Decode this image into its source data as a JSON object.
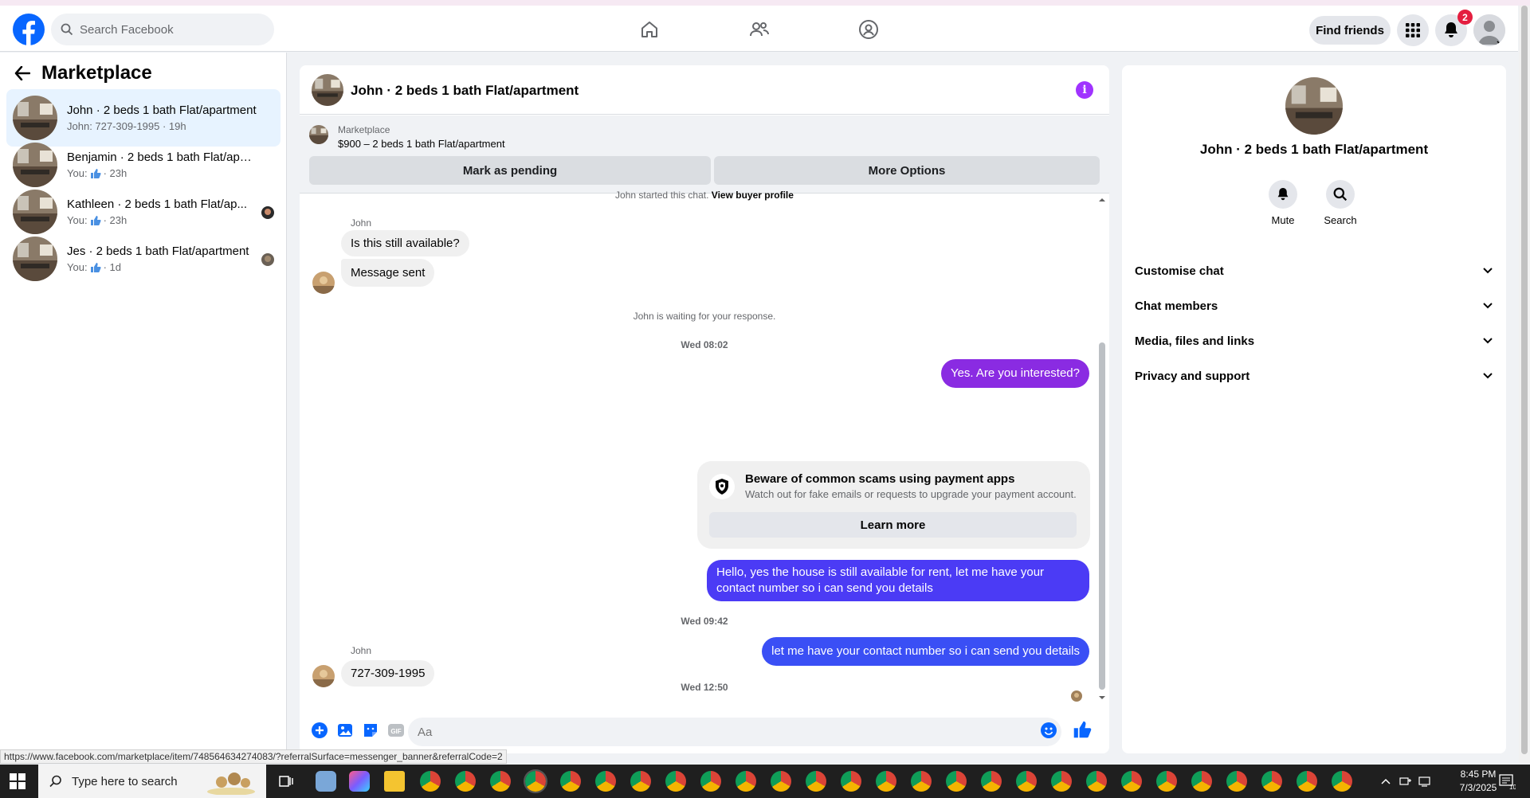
{
  "topnav": {
    "search_placeholder": "Search Facebook",
    "find_friends": "Find friends",
    "notification_count": "2"
  },
  "left": {
    "title": "Marketplace",
    "conversations": [
      {
        "title": "John · 2 beds 1 bath Flat/apartment",
        "sub": "John: 727-309-1995 · 19h",
        "active": true
      },
      {
        "title": "Benjamin · 2 beds 1 bath Flat/apar...",
        "you": "You:",
        "time": "· 23h"
      },
      {
        "title": "Kathleen · 2 beds 1 bath Flat/ap...",
        "you": "You:",
        "time": "· 23h"
      },
      {
        "title": "Jes · 2 beds 1 bath Flat/apartment",
        "you": "You:",
        "time": "· 1d"
      }
    ]
  },
  "chat": {
    "header_name": "John · 2 beds 1 bath Flat/apartment",
    "banner_label": "Marketplace",
    "banner_price": "$900 – 2 beds 1 bath Flat/apartment",
    "mark_pending": "Mark as pending",
    "more_options": "More Options",
    "started_text": "John started this chat.",
    "view_buyer_profile": "View buyer profile",
    "sender1": "John",
    "msg_in_1": "Is this still available?",
    "msg_in_2": "Message sent",
    "waiting": "John is waiting for your response.",
    "time1": "Wed 08:02",
    "msg_out_1": "Yes. Are you interested?",
    "scam_title": "Beware of common scams using payment apps",
    "scam_desc": "Watch out for fake emails or requests to upgrade your payment account.",
    "learn_more": "Learn more",
    "msg_out_2": "Hello, yes the house is still available for rent, let me have your contact number so i can send you details",
    "time2": "Wed 09:42",
    "msg_out_3": "let me have your contact number so i can send you details",
    "time3": "Wed 12:50",
    "sender2": "John",
    "msg_in_3": "727-309-1995",
    "composer_placeholder": "Aa"
  },
  "right": {
    "name": "John · 2 beds 1 bath Flat/apartment",
    "mute": "Mute",
    "search": "Search",
    "sections": [
      "Customise chat",
      "Chat members",
      "Media, files and links",
      "Privacy and support"
    ]
  },
  "status_url": "https://www.facebook.com/marketplace/item/748564634274083/?referralSurface=messenger_banner&referralCode=2",
  "taskbar": {
    "search_placeholder": "Type here to search",
    "time": "8:45 PM",
    "date": "7/3/2025",
    "notif_count": "10"
  },
  "colors": {
    "accent_blue": "#0866ff",
    "bubble_purple": "#8a2be2",
    "bubble_indigo": "#4b3bf5",
    "bubble_blue": "#3a4ff5"
  }
}
